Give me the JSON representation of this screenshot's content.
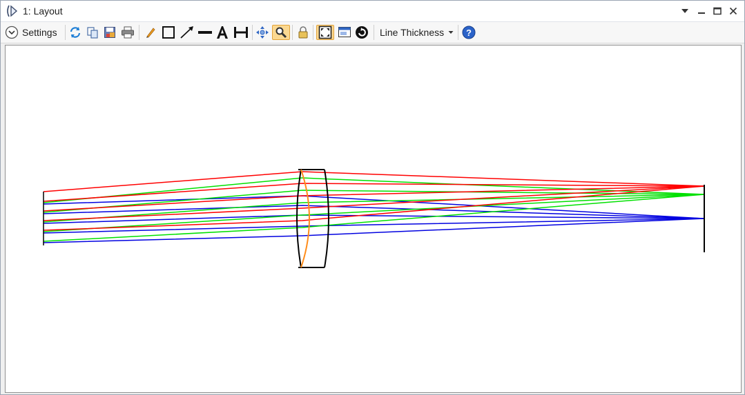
{
  "window": {
    "title": "1: Layout",
    "app_icon": "lens-layout-icon",
    "controls": [
      "dropdown-arrow-icon",
      "minimize-icon",
      "maximize-icon",
      "close-icon"
    ]
  },
  "toolbar": {
    "settings_label": "Settings",
    "line_thickness_label": "Line Thickness",
    "icons": [
      "refresh-icon",
      "copy-icon",
      "save-icon",
      "print-icon",
      "pencil-icon",
      "rectangle-icon",
      "arrow-line-icon",
      "line-icon",
      "text-icon",
      "dimension-icon",
      "pan-icon",
      "zoom-icon",
      "lock-icon",
      "fit-view-icon",
      "window-icon",
      "rotate-icon",
      "help-icon"
    ],
    "active_tools": [
      "zoom-icon",
      "fit-view-icon"
    ]
  },
  "colors": {
    "ray_field_1": "#ff0000",
    "ray_field_2": "#00e000",
    "ray_field_3": "#0000e0",
    "lens_outline": "#000000",
    "lens_cemented_surface": "#ff8c1a",
    "active_tool_bg": "#fbd891"
  },
  "layout_view": {
    "ray_fields": 3,
    "rays_per_field": 5,
    "elements": [
      "object-plane",
      "cemented-doublet-lens",
      "image-plane"
    ]
  }
}
